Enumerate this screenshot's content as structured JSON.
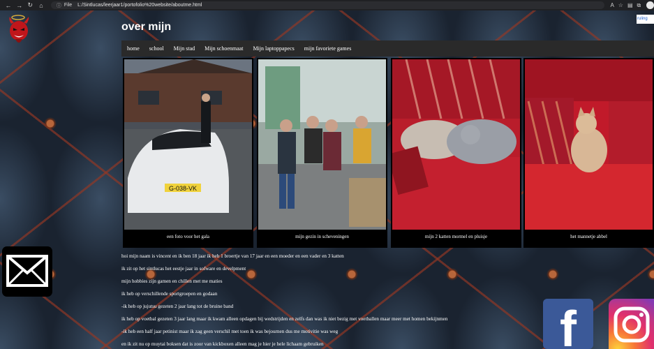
{
  "browser": {
    "nav_back": "←",
    "nav_forward": "→",
    "nav_reload": "↻",
    "nav_home": "⌂",
    "info_icon": "ⓘ",
    "scheme": "File",
    "url": "L:/Sintlucas/leerjaar1/portofolio%20website/aboutme.html"
  },
  "header": {
    "title": "over mijn",
    "corner_image_alt": "ruling"
  },
  "nav": [
    {
      "label": "home"
    },
    {
      "label": "school"
    },
    {
      "label": "Mijn stad"
    },
    {
      "label": "Mijn schoenmaat"
    },
    {
      "label": "Mijn laptoppapecs"
    },
    {
      "label": "mijn favoriete games"
    }
  ],
  "gallery": [
    {
      "caption": "een foto voor het gala",
      "plate": "G-038-VK"
    },
    {
      "caption": "mijn gezin in scheveningen"
    },
    {
      "caption": "mijn 2 katten mormel en pluisje"
    },
    {
      "caption": "het mannetje abbel"
    }
  ],
  "about": {
    "lines": [
      "hoi mijn naam is vincent en ik ben 18 jaar ik heb 1 broertje van 17 jaar en een moeder en een vader en 3 katten",
      "ik zit op het sintlucas het eestje jaar in sofware en develpment",
      "mijn hobbies zijn gamen en chillen met me maties",
      " ik heb op verschillende sportgroepen en godaan",
      "-ik heb op jujutsu gezeten 2 jaar lang tot de bruine band",
      " ik heb op voetbal gezeten 3 jaar lang maar ik kwam alleen opdagen bij wedstrijden en zelfs dan was ik niet bezig met voetballen maar meer met homen bekijnmen",
      "-ik heb een half jaar petinist maar ik zag geen verschil met toen ik was bejournen dus me motivitie was weg",
      " en ik zit nu op muytai boksen dat is zoor van kickboxen alleen mag je hier je hele lichaam gebruiken"
    ]
  },
  "colors": {
    "navbar_bg": "#2a2a2a",
    "facebook": "#3b5998",
    "text": "#ffffff"
  }
}
